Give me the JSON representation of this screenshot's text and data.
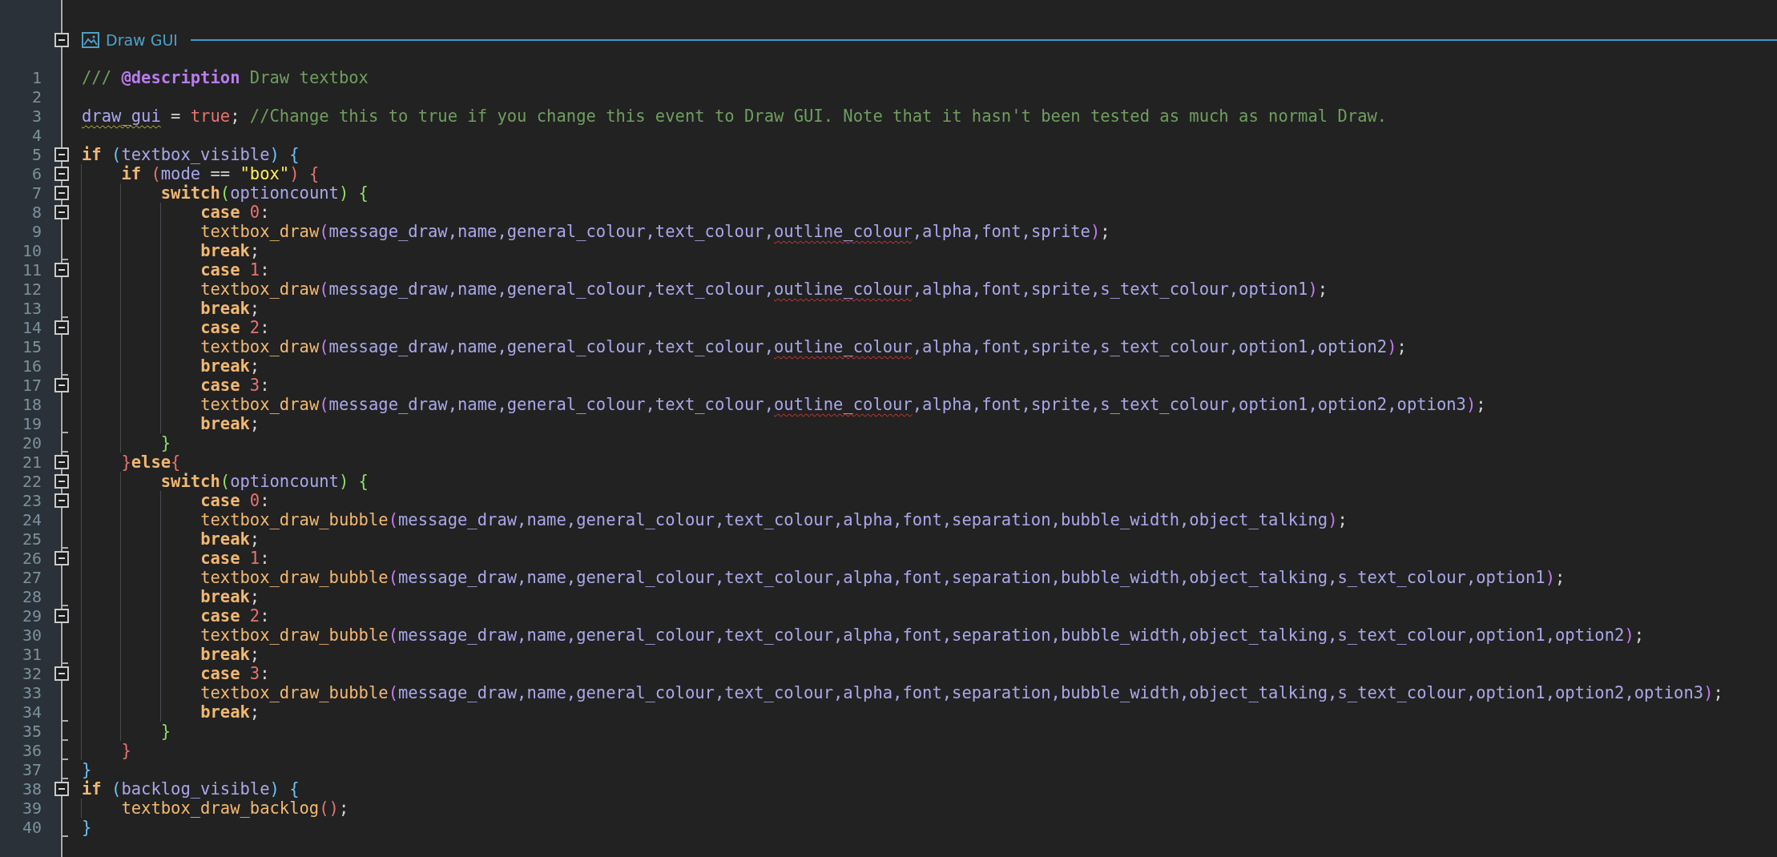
{
  "event_header": {
    "title": "Draw GUI",
    "collapsible": true
  },
  "lines": [
    {
      "number": "1",
      "collapsible": false,
      "block_end": false,
      "tokens": [
        {
          "kind": "cmt",
          "text": "/// "
        },
        {
          "kind": "doc",
          "text": "@description"
        },
        {
          "kind": "cmt",
          "text": " Draw textbox"
        }
      ]
    },
    {
      "number": "2",
      "collapsible": false,
      "block_end": false
    },
    {
      "number": "3",
      "collapsible": false,
      "block_end": false,
      "tokens": [
        {
          "kind": "var",
          "text": "draw_gui",
          "warning": true
        },
        {
          "kind": "op",
          "text": " = "
        },
        {
          "kind": "bool",
          "text": "true"
        },
        {
          "kind": "op",
          "text": ";"
        },
        {
          "kind": "cmt",
          "text": " //Change this to true if you change this event to Draw GUI. Note that it hasn't been tested as much as normal Draw."
        }
      ]
    },
    {
      "number": "4",
      "collapsible": false,
      "block_end": false
    },
    {
      "number": "5",
      "collapsible": true,
      "block_end": false,
      "tokens": [
        {
          "kind": "kw",
          "text": "if"
        },
        {
          "kind": "pb",
          "text": " ("
        },
        {
          "kind": "var",
          "text": "textbox_visible"
        },
        {
          "kind": "pb",
          "text": ") {"
        }
      ]
    },
    {
      "number": "6",
      "collapsible": true,
      "block_end": false,
      "tokens": [
        {
          "kind": "kw",
          "text": "    if"
        },
        {
          "kind": "pr",
          "text": " ("
        },
        {
          "kind": "var",
          "text": "mode"
        },
        {
          "kind": "op",
          "text": " == "
        },
        {
          "kind": "str",
          "text": "\"box\""
        },
        {
          "kind": "pr",
          "text": ") {"
        }
      ]
    },
    {
      "number": "7",
      "collapsible": true,
      "block_end": false,
      "tokens": [
        {
          "kind": "kw",
          "text": "        switch"
        },
        {
          "kind": "pg",
          "text": "("
        },
        {
          "kind": "var",
          "text": "optioncount"
        },
        {
          "kind": "pg",
          "text": ") {"
        }
      ]
    },
    {
      "number": "8",
      "collapsible": true,
      "block_end": false,
      "tokens": [
        {
          "kind": "kw",
          "text": "            case"
        },
        {
          "kind": "num",
          "text": " 0"
        },
        {
          "kind": "op",
          "text": ":"
        }
      ]
    },
    {
      "number": "9",
      "collapsible": false,
      "block_end": false,
      "tokens": [
        {
          "kind": "fn",
          "text": "            textbox_draw"
        },
        {
          "kind": "pp",
          "text": "("
        },
        {
          "kind": "var",
          "text": "message_draw,name,general_colour,text_colour,"
        },
        {
          "kind": "var",
          "text": "outline_colour",
          "error": true
        },
        {
          "kind": "var",
          "text": ",alpha,font,sprite"
        },
        {
          "kind": "pp",
          "text": ")"
        },
        {
          "kind": "op",
          "text": ";"
        }
      ]
    },
    {
      "number": "10",
      "collapsible": false,
      "block_end": true,
      "tokens": [
        {
          "kind": "kw",
          "text": "            break"
        },
        {
          "kind": "op",
          "text": ";"
        }
      ]
    },
    {
      "number": "11",
      "collapsible": true,
      "block_end": false,
      "tokens": [
        {
          "kind": "kw",
          "text": "            case"
        },
        {
          "kind": "num",
          "text": " 1"
        },
        {
          "kind": "op",
          "text": ":"
        }
      ]
    },
    {
      "number": "12",
      "collapsible": false,
      "block_end": false,
      "tokens": [
        {
          "kind": "fn",
          "text": "            textbox_draw"
        },
        {
          "kind": "pp",
          "text": "("
        },
        {
          "kind": "var",
          "text": "message_draw,name,general_colour,text_colour,"
        },
        {
          "kind": "var",
          "text": "outline_colour",
          "error": true
        },
        {
          "kind": "var",
          "text": ",alpha,font,sprite,s_text_colour,option1"
        },
        {
          "kind": "pp",
          "text": ")"
        },
        {
          "kind": "op",
          "text": ";"
        }
      ]
    },
    {
      "number": "13",
      "collapsible": false,
      "block_end": true,
      "tokens": [
        {
          "kind": "kw",
          "text": "            break"
        },
        {
          "kind": "op",
          "text": ";"
        }
      ]
    },
    {
      "number": "14",
      "collapsible": true,
      "block_end": false,
      "tokens": [
        {
          "kind": "kw",
          "text": "            case"
        },
        {
          "kind": "num",
          "text": " 2"
        },
        {
          "kind": "op",
          "text": ":"
        }
      ]
    },
    {
      "number": "15",
      "collapsible": false,
      "block_end": false,
      "tokens": [
        {
          "kind": "fn",
          "text": "            textbox_draw"
        },
        {
          "kind": "pp",
          "text": "("
        },
        {
          "kind": "var",
          "text": "message_draw,name,general_colour,text_colour,"
        },
        {
          "kind": "var",
          "text": "outline_colour",
          "error": true
        },
        {
          "kind": "var",
          "text": ",alpha,font,sprite,s_text_colour,option1,option2"
        },
        {
          "kind": "pp",
          "text": ")"
        },
        {
          "kind": "op",
          "text": ";"
        }
      ]
    },
    {
      "number": "16",
      "collapsible": false,
      "block_end": true,
      "tokens": [
        {
          "kind": "kw",
          "text": "            break"
        },
        {
          "kind": "op",
          "text": ";"
        }
      ]
    },
    {
      "number": "17",
      "collapsible": true,
      "block_end": false,
      "tokens": [
        {
          "kind": "kw",
          "text": "            case"
        },
        {
          "kind": "num",
          "text": " 3"
        },
        {
          "kind": "op",
          "text": ":"
        }
      ]
    },
    {
      "number": "18",
      "collapsible": false,
      "block_end": false,
      "tokens": [
        {
          "kind": "fn",
          "text": "            textbox_draw"
        },
        {
          "kind": "pp",
          "text": "("
        },
        {
          "kind": "var",
          "text": "message_draw,name,general_colour,text_colour,"
        },
        {
          "kind": "var",
          "text": "outline_colour",
          "error": true
        },
        {
          "kind": "var",
          "text": ",alpha,font,sprite,s_text_colour,option1,option2,option3"
        },
        {
          "kind": "pp",
          "text": ")"
        },
        {
          "kind": "op",
          "text": ";"
        }
      ]
    },
    {
      "number": "19",
      "collapsible": false,
      "block_end": true,
      "tokens": [
        {
          "kind": "kw",
          "text": "            break"
        },
        {
          "kind": "op",
          "text": ";"
        }
      ]
    },
    {
      "number": "20",
      "collapsible": false,
      "block_end": true,
      "tokens": [
        {
          "kind": "pg",
          "text": "        }"
        }
      ]
    },
    {
      "number": "21",
      "collapsible": true,
      "block_end": false,
      "tokens": [
        {
          "kind": "pr",
          "text": "    }"
        },
        {
          "kind": "kw",
          "text": "else"
        },
        {
          "kind": "pr",
          "text": "{"
        }
      ]
    },
    {
      "number": "22",
      "collapsible": true,
      "block_end": false,
      "tokens": [
        {
          "kind": "kw",
          "text": "        switch"
        },
        {
          "kind": "pg",
          "text": "("
        },
        {
          "kind": "var",
          "text": "optioncount"
        },
        {
          "kind": "pg",
          "text": ") {"
        }
      ]
    },
    {
      "number": "23",
      "collapsible": true,
      "block_end": false,
      "tokens": [
        {
          "kind": "kw",
          "text": "            case"
        },
        {
          "kind": "num",
          "text": " 0"
        },
        {
          "kind": "op",
          "text": ":"
        }
      ]
    },
    {
      "number": "24",
      "collapsible": false,
      "block_end": false,
      "tokens": [
        {
          "kind": "fn",
          "text": "            textbox_draw_bubble"
        },
        {
          "kind": "pp",
          "text": "("
        },
        {
          "kind": "var",
          "text": "message_draw,name,general_colour,text_colour,alpha,font,separation,bubble_width,object_talking"
        },
        {
          "kind": "pp",
          "text": ")"
        },
        {
          "kind": "op",
          "text": ";"
        }
      ]
    },
    {
      "number": "25",
      "collapsible": false,
      "block_end": true,
      "tokens": [
        {
          "kind": "kw",
          "text": "            break"
        },
        {
          "kind": "op",
          "text": ";"
        }
      ]
    },
    {
      "number": "26",
      "collapsible": true,
      "block_end": false,
      "tokens": [
        {
          "kind": "kw",
          "text": "            case"
        },
        {
          "kind": "num",
          "text": " 1"
        },
        {
          "kind": "op",
          "text": ":"
        }
      ]
    },
    {
      "number": "27",
      "collapsible": false,
      "block_end": false,
      "tokens": [
        {
          "kind": "fn",
          "text": "            textbox_draw_bubble"
        },
        {
          "kind": "pp",
          "text": "("
        },
        {
          "kind": "var",
          "text": "message_draw,name,general_colour,text_colour,alpha,font,separation,bubble_width,object_talking,s_text_colour,option1"
        },
        {
          "kind": "pp",
          "text": ")"
        },
        {
          "kind": "op",
          "text": ";"
        }
      ]
    },
    {
      "number": "28",
      "collapsible": false,
      "block_end": true,
      "tokens": [
        {
          "kind": "kw",
          "text": "            break"
        },
        {
          "kind": "op",
          "text": ";"
        }
      ]
    },
    {
      "number": "29",
      "collapsible": true,
      "block_end": false,
      "tokens": [
        {
          "kind": "kw",
          "text": "            case"
        },
        {
          "kind": "num",
          "text": " 2"
        },
        {
          "kind": "op",
          "text": ":"
        }
      ]
    },
    {
      "number": "30",
      "collapsible": false,
      "block_end": false,
      "tokens": [
        {
          "kind": "fn",
          "text": "            textbox_draw_bubble"
        },
        {
          "kind": "pp",
          "text": "("
        },
        {
          "kind": "var",
          "text": "message_draw,name,general_colour,text_colour,alpha,font,separation,bubble_width,object_talking,s_text_colour,option1,option2"
        },
        {
          "kind": "pp",
          "text": ")"
        },
        {
          "kind": "op",
          "text": ";"
        }
      ]
    },
    {
      "number": "31",
      "collapsible": false,
      "block_end": true,
      "tokens": [
        {
          "kind": "kw",
          "text": "            break"
        },
        {
          "kind": "op",
          "text": ";"
        }
      ]
    },
    {
      "number": "32",
      "collapsible": true,
      "block_end": false,
      "tokens": [
        {
          "kind": "kw",
          "text": "            case"
        },
        {
          "kind": "num",
          "text": " 3"
        },
        {
          "kind": "op",
          "text": ":"
        }
      ]
    },
    {
      "number": "33",
      "collapsible": false,
      "block_end": false,
      "tokens": [
        {
          "kind": "fn",
          "text": "            textbox_draw_bubble"
        },
        {
          "kind": "pp",
          "text": "("
        },
        {
          "kind": "var",
          "text": "message_draw,name,general_colour,text_colour,alpha,font,separation,bubble_width,object_talking,s_text_colour,option1,option2,option3"
        },
        {
          "kind": "pp",
          "text": ")"
        },
        {
          "kind": "op",
          "text": ";"
        }
      ]
    },
    {
      "number": "34",
      "collapsible": false,
      "block_end": true,
      "tokens": [
        {
          "kind": "kw",
          "text": "            break"
        },
        {
          "kind": "op",
          "text": ";"
        }
      ]
    },
    {
      "number": "35",
      "collapsible": false,
      "block_end": true,
      "tokens": [
        {
          "kind": "pg",
          "text": "        }"
        }
      ]
    },
    {
      "number": "36",
      "collapsible": false,
      "block_end": true,
      "tokens": [
        {
          "kind": "pr",
          "text": "    }"
        }
      ]
    },
    {
      "number": "37",
      "collapsible": false,
      "block_end": true,
      "tokens": [
        {
          "kind": "pb",
          "text": "}"
        }
      ]
    },
    {
      "number": "38",
      "collapsible": true,
      "block_end": false,
      "tokens": [
        {
          "kind": "kw",
          "text": "if"
        },
        {
          "kind": "pb",
          "text": " ("
        },
        {
          "kind": "var",
          "text": "backlog_visible"
        },
        {
          "kind": "pb",
          "text": ") {"
        }
      ]
    },
    {
      "number": "39",
      "collapsible": false,
      "block_end": false,
      "tokens": [
        {
          "kind": "fn",
          "text": "    textbox_draw_backlog"
        },
        {
          "kind": "pr",
          "text": "()"
        },
        {
          "kind": "op",
          "text": ";"
        }
      ]
    },
    {
      "number": "40",
      "collapsible": false,
      "block_end": true,
      "tokens": [
        {
          "kind": "pb",
          "text": "}"
        }
      ]
    }
  ]
}
